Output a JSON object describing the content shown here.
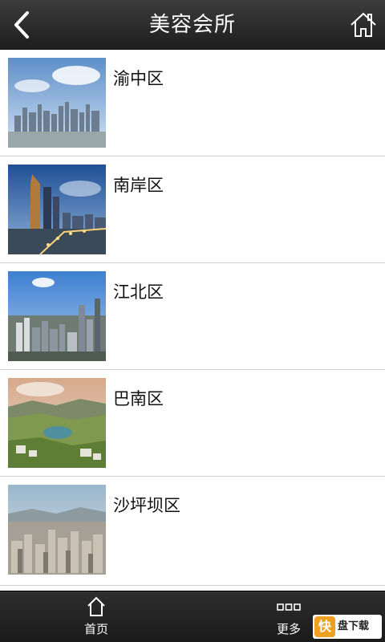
{
  "header": {
    "title": "美容会所",
    "back_icon": "back-arrow-icon",
    "home_icon": "home-icon"
  },
  "districts": [
    {
      "name": "渝中区",
      "image": "city-skyline-photo"
    },
    {
      "name": "南岸区",
      "image": "riverside-towers-photo"
    },
    {
      "name": "江北区",
      "image": "city-highrises-photo"
    },
    {
      "name": "巴南区",
      "image": "green-hills-lake-photo"
    },
    {
      "name": "沙坪坝区",
      "image": "dense-city-photo"
    }
  ],
  "bottom_nav": {
    "home_label": "首页",
    "more_label": "更多"
  },
  "watermark": {
    "badge": "快",
    "title": "盘下载"
  }
}
